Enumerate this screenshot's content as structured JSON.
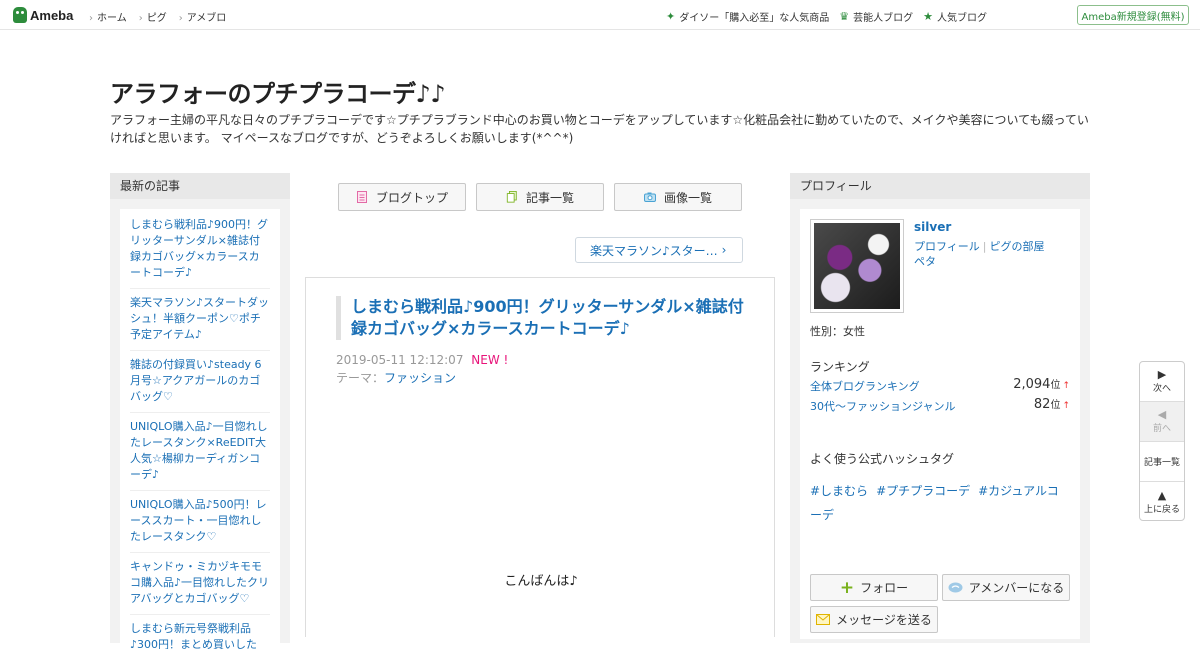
{
  "topbar": {
    "logo": "Ameba",
    "nav": [
      "ホーム",
      "ピグ",
      "アメブロ"
    ],
    "right_links": [
      {
        "label": "ダイソー「購入必至」な人気商品",
        "icon": "sparkle-icon"
      },
      {
        "label": "芸能人ブログ",
        "icon": "crown-icon"
      },
      {
        "label": "人気ブログ",
        "icon": "star-icon"
      }
    ],
    "signup": "Ameba新規登録(無料)"
  },
  "header": {
    "title": "アラフォーのプチプラコーデ♪♪",
    "description": "アラフォー主婦の平凡な日々のプチプラコーデです☆プチプラブランド中心のお買い物とコーデをアップしています☆化粧品会社に勤めていたので、メイクや美容についても綴っていければと思います。 マイペースなブログですが、どうぞよろしくお願いします(*^^*)"
  },
  "left": {
    "heading": "最新の記事",
    "items": [
      "しまむら戦利品♪900円！グリッターサンダル×雑誌付録カゴバッグ×カラースカートコーデ♪",
      "楽天マラソン♪スタートダッシュ！半額クーポン♡ポチ予定アイテム♪",
      "雑誌の付録買い♪steady 6月号☆アクアガールのカゴバッグ♡",
      "UNIQLO購入品♪一目惚れしたレースタンク×ReEDIT大人気☆楊柳カーディガンコーデ♪",
      "UNIQLO購入品♪500円！レーススカート・一目惚れしたレースタンク♡",
      "キャンドゥ・ミカヅキモモコ購入品♪一目惚れしたクリアバッグとカゴバッグ♡",
      "しまむら新元号祭戦利品♪300円！まとめ買いした"
    ]
  },
  "center": {
    "buttons": [
      {
        "label": "ブログトップ",
        "icon": "document-icon"
      },
      {
        "label": "記事一覧",
        "icon": "list-icon"
      },
      {
        "label": "画像一覧",
        "icon": "camera-icon"
      }
    ],
    "next_link": "楽天マラソン♪スター…",
    "article": {
      "title": "しまむら戦利品♪900円！グリッターサンダル×雑誌付録カゴバッグ×カラースカートコーデ♪",
      "date": "2019-05-11 12:12:07",
      "new_badge": "NEW !",
      "theme_label": "テーマ：",
      "theme": "ファッション",
      "body_first_line": "こんばんは♪"
    }
  },
  "right": {
    "heading": "プロフィール",
    "name": "silver",
    "links": [
      "プロフィール",
      "ピグの部屋",
      "ペタ"
    ],
    "gender": "性別：女性",
    "ranking_heading": "ランキング",
    "rankings": [
      {
        "label": "全体ブログランキング",
        "value": "2,094",
        "unit": "位",
        "trend": "↑"
      },
      {
        "label": "30代〜ファッションジャンル",
        "value": "82",
        "unit": "位",
        "trend": "↑"
      }
    ],
    "hashtag_heading": "よく使う公式ハッシュタグ",
    "hashtags": [
      "#しまむら",
      "#プチプラコーデ",
      "#カジュアルコーデ"
    ],
    "follow": "フォロー",
    "member": "アメンバーになる",
    "message": "メッセージを送る"
  },
  "floatnav": {
    "next": "次へ",
    "prev": "前へ",
    "list": "記事一覧",
    "top": "上に戻る"
  },
  "colors": {
    "brand_green": "#2d8c3c",
    "link_blue": "#1a6fb5",
    "new_pink": "#e8147a"
  }
}
